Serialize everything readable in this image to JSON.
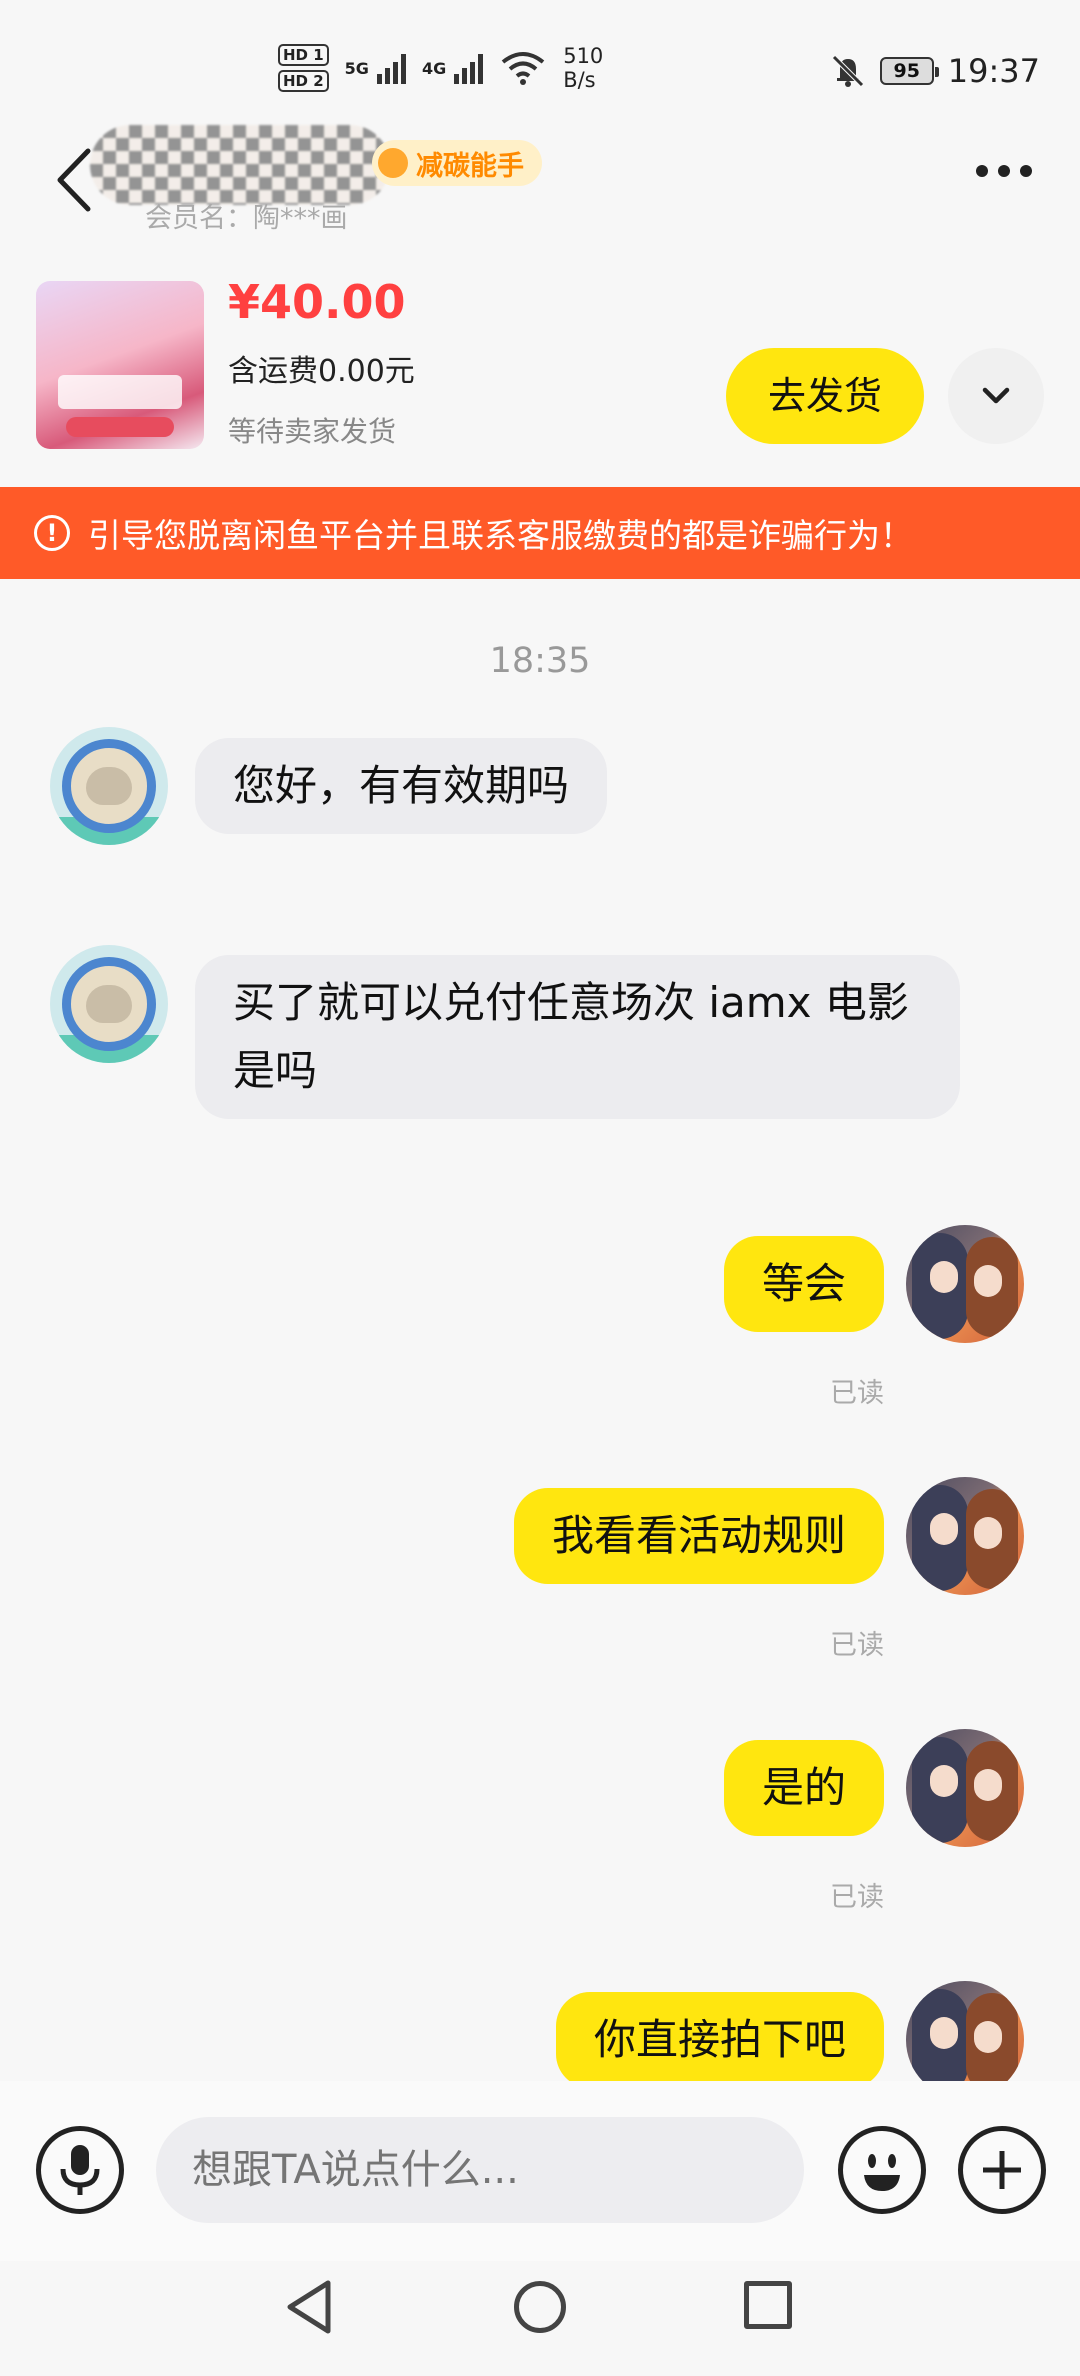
{
  "status_bar": {
    "hd1": "HD 1",
    "hd2": "HD 2",
    "sig1": "5G",
    "sig2": "4G",
    "speed_value": "510",
    "speed_unit": "B/s",
    "battery": "95",
    "time": "19:37"
  },
  "header": {
    "badge": "减碳能手",
    "member": "会员名：陶***画"
  },
  "product": {
    "price": "¥40.00",
    "shipping": "含运费0.00元",
    "status": "等待卖家发货",
    "ship_button": "去发货"
  },
  "warning": {
    "text": "引导您脱离闲鱼平台并且联系客服缴费的都是诈骗行为！"
  },
  "chat": {
    "time": "18:35",
    "messages": [
      {
        "dir": "in",
        "text": "您好，有有效期吗"
      },
      {
        "dir": "in",
        "text": "买了就可以兑付任意场次 iamx 电影是吗"
      },
      {
        "dir": "out",
        "text": "等会",
        "status": "已读"
      },
      {
        "dir": "out",
        "text": "我看看活动规则",
        "status": "已读"
      },
      {
        "dir": "out",
        "text": "是的",
        "status": "已读"
      },
      {
        "dir": "out",
        "text": "你直接拍下吧"
      }
    ]
  },
  "input": {
    "placeholder": "想跟TA说点什么..."
  },
  "colors": {
    "accent_yellow": "#ffe60f",
    "price_red": "#ff4040",
    "warning_orange": "#ff5a28"
  },
  "icons": [
    "back-icon",
    "more-icon",
    "chevron-down-icon",
    "warning-icon",
    "mic-icon",
    "emoji-icon",
    "plus-icon",
    "nav-back-icon",
    "nav-home-icon",
    "nav-recent-icon"
  ]
}
